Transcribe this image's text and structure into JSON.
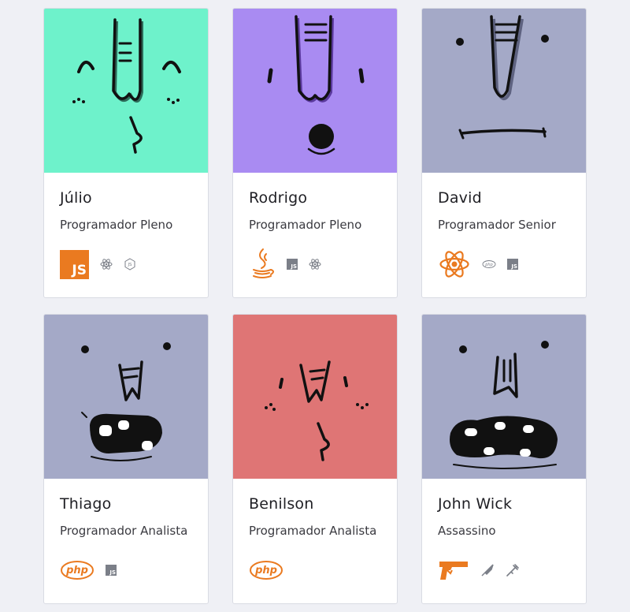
{
  "colors": {
    "page_bg": "#eff0f5",
    "accent_orange": "#ea7a20",
    "muted_icon": "#7b7f88",
    "avatar_teal": "#6ef2cb",
    "avatar_purple": "#a98bf2",
    "avatar_slate": "#a4a9c7",
    "avatar_salmon": "#df7575"
  },
  "cards": [
    {
      "name": "Júlio",
      "role": "Programador Pleno",
      "avatar_icon": "face-smirk-icon",
      "skills": [
        "js-logo-icon-large",
        "react-icon",
        "nodejs-icon"
      ]
    },
    {
      "name": "Rodrigo",
      "role": "Programador Pleno",
      "avatar_icon": "face-surprised-icon",
      "skills": [
        "java-icon-large",
        "js-icon",
        "react-icon"
      ]
    },
    {
      "name": "David",
      "role": "Programador Senior",
      "avatar_icon": "face-neutral-icon",
      "skills": [
        "react-icon-large",
        "php-icon",
        "js-icon"
      ]
    },
    {
      "name": "Thiago",
      "role": "Programador Analista",
      "avatar_icon": "face-grin-icon",
      "skills": [
        "php-icon-large",
        "js-icon"
      ]
    },
    {
      "name": "Benilson",
      "role": "Programador Analista",
      "avatar_icon": "face-smirk-icon",
      "skills": [
        "php-icon-large"
      ]
    },
    {
      "name": "John Wick",
      "role": "Assassino",
      "avatar_icon": "face-scream-icon",
      "skills": [
        "pistol-icon-large",
        "knife-icon",
        "syringe-icon"
      ]
    }
  ],
  "js_label": "JS",
  "php_label": "php"
}
